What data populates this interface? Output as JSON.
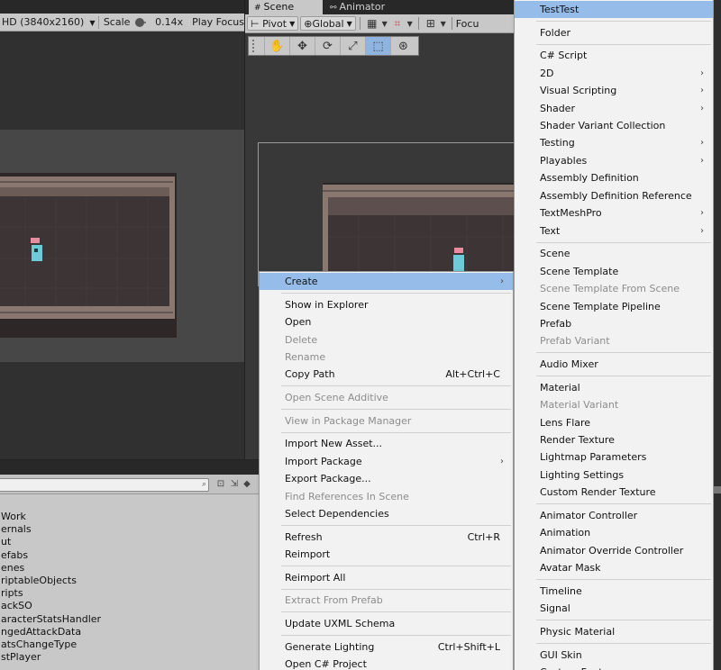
{
  "game_view": {
    "resolution_label": "HD (3840x2160)",
    "scale_label": "Scale",
    "scale_value": "0.14x",
    "play_focus_label": "Play Focus"
  },
  "scene_view": {
    "tabs": [
      {
        "label": "Scene",
        "icon": "grid-icon"
      },
      {
        "label": "Animator",
        "icon": "animator-icon"
      }
    ],
    "pivot_label": "Pivot",
    "global_label": "Global",
    "focus_label": "Focu",
    "tools": [
      "hand-tool",
      "move-tool",
      "rotate-tool",
      "scale-tool",
      "rect-tool",
      "transform-tool"
    ],
    "selected_tool_index": 4
  },
  "project": {
    "items": [
      "Work",
      "ernals",
      "ut",
      "efabs",
      "enes",
      "riptableObjects",
      "ripts",
      "ackSO",
      "aracterStatsHandler",
      "ngedAttackData",
      "atsChangeType",
      "stPlayer"
    ]
  },
  "context_menu": {
    "items": [
      {
        "label": "Create",
        "submenu": true,
        "highlighted": true
      },
      {
        "sep": true
      },
      {
        "label": "Show in Explorer"
      },
      {
        "label": "Open"
      },
      {
        "label": "Delete",
        "disabled": true
      },
      {
        "label": "Rename",
        "disabled": true
      },
      {
        "label": "Copy Path",
        "shortcut": "Alt+Ctrl+C"
      },
      {
        "sep": true
      },
      {
        "label": "Open Scene Additive",
        "disabled": true
      },
      {
        "sep": true
      },
      {
        "label": "View in Package Manager",
        "disabled": true
      },
      {
        "sep": true
      },
      {
        "label": "Import New Asset..."
      },
      {
        "label": "Import Package",
        "submenu": true
      },
      {
        "label": "Export Package..."
      },
      {
        "label": "Find References In Scene",
        "disabled": true
      },
      {
        "label": "Select Dependencies"
      },
      {
        "sep": true
      },
      {
        "label": "Refresh",
        "shortcut": "Ctrl+R"
      },
      {
        "label": "Reimport"
      },
      {
        "sep": true
      },
      {
        "label": "Reimport All"
      },
      {
        "sep": true
      },
      {
        "label": "Extract From Prefab",
        "disabled": true
      },
      {
        "sep": true
      },
      {
        "label": "Update UXML Schema"
      },
      {
        "sep": true
      },
      {
        "label": "Generate Lighting",
        "shortcut": "Ctrl+Shift+L"
      },
      {
        "label": "Open C# Project"
      }
    ]
  },
  "create_menu": {
    "items": [
      {
        "label": "TestTest",
        "highlighted": true
      },
      {
        "sep": true
      },
      {
        "label": "Folder"
      },
      {
        "sep": true
      },
      {
        "label": "C# Script"
      },
      {
        "label": "2D",
        "submenu": true
      },
      {
        "label": "Visual Scripting",
        "submenu": true
      },
      {
        "label": "Shader",
        "submenu": true
      },
      {
        "label": "Shader Variant Collection"
      },
      {
        "label": "Testing",
        "submenu": true
      },
      {
        "label": "Playables",
        "submenu": true
      },
      {
        "label": "Assembly Definition"
      },
      {
        "label": "Assembly Definition Reference"
      },
      {
        "label": "TextMeshPro",
        "submenu": true
      },
      {
        "label": "Text",
        "submenu": true
      },
      {
        "sep": true
      },
      {
        "label": "Scene"
      },
      {
        "label": "Scene Template"
      },
      {
        "label": "Scene Template From Scene",
        "disabled": true
      },
      {
        "label": "Scene Template Pipeline"
      },
      {
        "label": "Prefab"
      },
      {
        "label": "Prefab Variant",
        "disabled": true
      },
      {
        "sep": true
      },
      {
        "label": "Audio Mixer"
      },
      {
        "sep": true
      },
      {
        "label": "Material"
      },
      {
        "label": "Material Variant",
        "disabled": true
      },
      {
        "label": "Lens Flare"
      },
      {
        "label": "Render Texture"
      },
      {
        "label": "Lightmap Parameters"
      },
      {
        "label": "Lighting Settings"
      },
      {
        "label": "Custom Render Texture"
      },
      {
        "sep": true
      },
      {
        "label": "Animator Controller"
      },
      {
        "label": "Animation"
      },
      {
        "label": "Animator Override Controller"
      },
      {
        "label": "Avatar Mask"
      },
      {
        "sep": true
      },
      {
        "label": "Timeline"
      },
      {
        "label": "Signal"
      },
      {
        "sep": true
      },
      {
        "label": "Physic Material"
      },
      {
        "sep": true
      },
      {
        "label": "GUI Skin"
      },
      {
        "label": "Custom Font"
      }
    ]
  },
  "colors": {
    "highlight": "#96bce9",
    "menu_bg": "#f2f2f2",
    "editor_dark": "#383838",
    "disabled_text": "#8c8c8c"
  }
}
